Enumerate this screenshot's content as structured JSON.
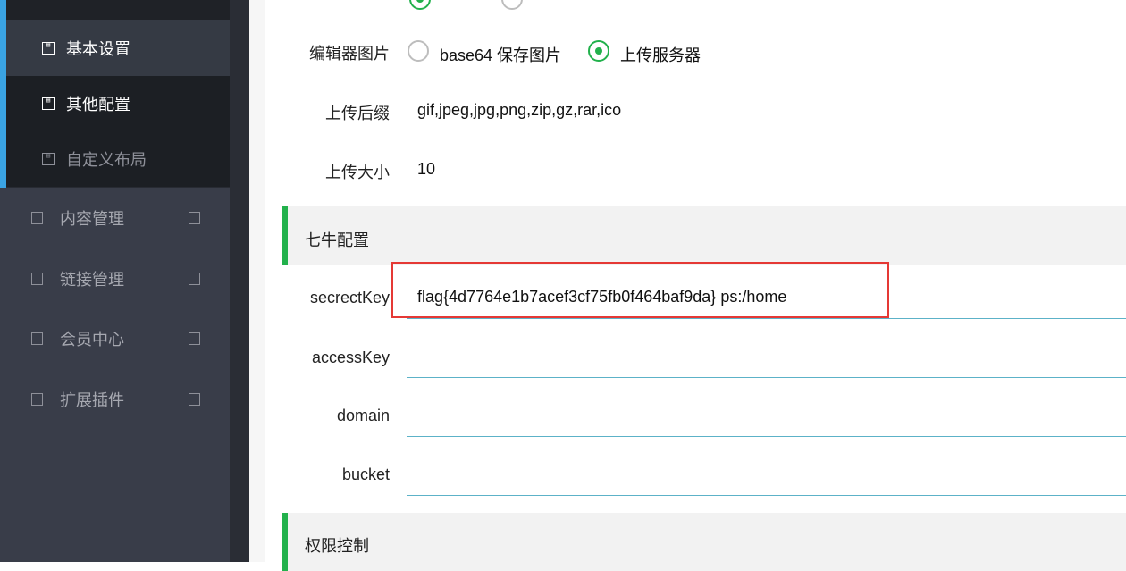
{
  "sidebar": {
    "sub_items": [
      {
        "label": "基本设置",
        "icon": "doc-icon"
      },
      {
        "label": "其他配置",
        "icon": "doc-icon"
      },
      {
        "label": "自定义布局",
        "icon": "doc-icon"
      }
    ],
    "nav_items": [
      {
        "label": "内容管理",
        "icon": "doc-icon",
        "arrow": "expand-icon"
      },
      {
        "label": "链接管理",
        "icon": "doc-icon",
        "arrow": "expand-icon"
      },
      {
        "label": "会员中心",
        "icon": "doc-icon",
        "arrow": "expand-icon"
      },
      {
        "label": "扩展插件",
        "icon": "doc-icon",
        "arrow": "expand-icon"
      }
    ]
  },
  "form": {
    "editor_image": {
      "label": "编辑器图片",
      "options": [
        "base64 保存图片",
        "上传服务器"
      ],
      "selected": "上传服务器"
    },
    "upload_ext": {
      "label": "上传后缀",
      "value": "gif,jpeg,jpg,png,zip,gz,rar,ico"
    },
    "upload_size": {
      "label": "上传大小",
      "value": "10"
    },
    "qiniu": {
      "title": "七牛配置",
      "secret_key": {
        "label": "secrectKey",
        "value": "flag{4d7764e1b7acef3cf75fb0f464baf9da} ps:/home"
      },
      "access_key": {
        "label": "accessKey",
        "value": ""
      },
      "domain": {
        "label": "domain",
        "value": ""
      },
      "bucket": {
        "label": "bucket",
        "value": ""
      }
    },
    "permission": {
      "title": "权限控制"
    }
  },
  "colors": {
    "accent_green": "#22b14c",
    "sidebar_bg": "#393d49",
    "active_bar": "#3aa3e3",
    "input_underline": "#5cb2c8",
    "highlight_red": "#e53935"
  }
}
